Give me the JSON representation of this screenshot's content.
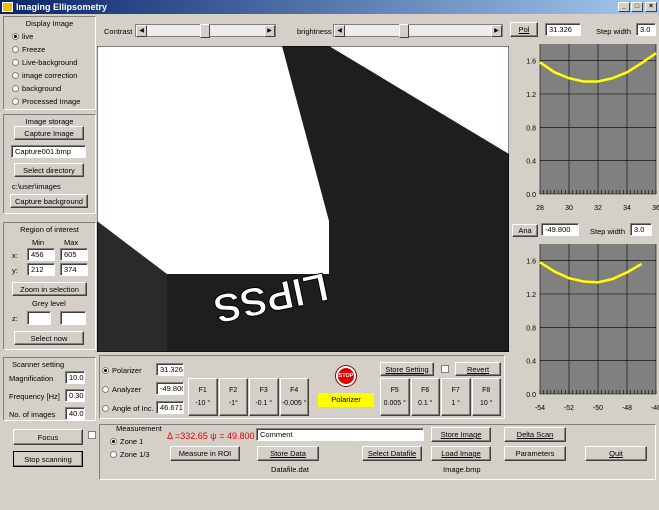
{
  "window": {
    "title": "Imaging Ellipsometry"
  },
  "display": {
    "title": "Display Image",
    "options": [
      "live",
      "Freeze",
      "Live-background",
      "image correction",
      "background",
      "Processed Image"
    ],
    "selected": 0
  },
  "storage": {
    "title": "Image storage",
    "capture_label": "Capture Image",
    "filename": "Capture001.bmp",
    "select_dir_label": "Select directory",
    "path": "c:\\user\\images",
    "capture_bg_label": "Capture background"
  },
  "roi": {
    "title": "Region of interest",
    "min_label": "Min",
    "max_label": "Max",
    "x_label": "x:",
    "y_label": "y:",
    "x_min": "456",
    "x_max": "605",
    "y_min": "212",
    "y_max": "374",
    "zoom_label": "Zoom in selection",
    "grey_label": "Grey level",
    "z_label": "z:",
    "select_label": "Select now"
  },
  "scanner": {
    "title": "Scanner setting",
    "mag_label": "Magnification",
    "mag": "10.0",
    "freq_label": "Frequency [Hz]",
    "freq": "0.30",
    "num_label": "No. of images",
    "num": "40.0"
  },
  "buttons": {
    "focus": "Focus",
    "stop_scanning": "Stop scanning"
  },
  "top": {
    "contrast_label": "Contrast",
    "brightness_label": "brightness",
    "pol_label": "Pol",
    "pol_value": "31.326",
    "step_label": "Step width",
    "step_value": "3.0"
  },
  "ana": {
    "label": "Ana",
    "value": "-49.800",
    "step_label": "Step width",
    "step_value": "3.0"
  },
  "image": {
    "text": "LIPSS"
  },
  "angles": {
    "polarizer_label": "Polarizer",
    "polarizer": "31.326",
    "analyzer_label": "Analyzer",
    "analyzer": "-49.800",
    "aoi_label": "Angle of Inc.",
    "aoi": "46.671",
    "selected": 0,
    "f_left": [
      {
        "label": "F1",
        "value": "-10 °"
      },
      {
        "label": "F2",
        "value": "-1°"
      },
      {
        "label": "F3",
        "value": "-0.1 °"
      },
      {
        "label": "F4",
        "value": "-0,005 °"
      }
    ],
    "f_right": [
      {
        "label": "F5",
        "value": "0.005 °"
      },
      {
        "label": "F6",
        "value": "0.1 °"
      },
      {
        "label": "F7",
        "value": "1 °"
      },
      {
        "label": "F8",
        "value": "10 °"
      }
    ],
    "stop_label": "STOP",
    "active_label": "Polarizer",
    "store_setting_label": "Store Setting",
    "revert_label": "Revert"
  },
  "measurement": {
    "title": "Measurement",
    "zone1": "Zone 1",
    "zone13": "Zone 1/3",
    "delta_psi": "Δ =332.65 ψ = 49.800",
    "comment": "Comment",
    "measure_label": "Measure in ROI",
    "store_data_label": "Store Data",
    "datafile": "Datafile.dat",
    "select_datafile_label": "Select Datafile",
    "store_image_label": "Store Image",
    "load_image_label": "Load Image",
    "imagefile": "Image.bmp",
    "delta_scan_label": "Delta Scan",
    "parameters_label": "Parameters",
    "quit_label": "Quit"
  },
  "colors": {
    "curve": "#ffff00",
    "plot_bg": "#808080",
    "stop": "#e00000",
    "active": "#ffff00"
  },
  "chart_data": [
    {
      "type": "line",
      "series": [
        {
          "x": [
            28,
            29,
            30,
            31,
            32,
            33,
            34,
            35,
            36
          ],
          "y": [
            1.58,
            1.46,
            1.39,
            1.35,
            1.35,
            1.39,
            1.46,
            1.57,
            1.69
          ]
        }
      ],
      "xlim": [
        28,
        36
      ],
      "ylim": [
        0,
        1.8
      ],
      "xticks": [
        "28",
        "30",
        "32",
        "34",
        "36"
      ],
      "yticks": [
        "0.0",
        "0.4",
        "0.8",
        "1.2",
        "1.6"
      ],
      "grid": true
    },
    {
      "type": "line",
      "series": [
        {
          "x": [
            -54,
            -53,
            -52,
            -51,
            -50,
            -49,
            -48,
            -47
          ],
          "y": [
            1.58,
            1.47,
            1.39,
            1.35,
            1.34,
            1.38,
            1.46,
            1.56
          ]
        }
      ],
      "xlim": [
        -54,
        -46
      ],
      "ylim": [
        0,
        1.8
      ],
      "xticks": [
        "-54",
        "-52",
        "-50",
        "-48",
        "-46"
      ],
      "yticks": [
        "0.0",
        "0.4",
        "0.8",
        "1.2",
        "1.6"
      ],
      "grid": true
    }
  ]
}
